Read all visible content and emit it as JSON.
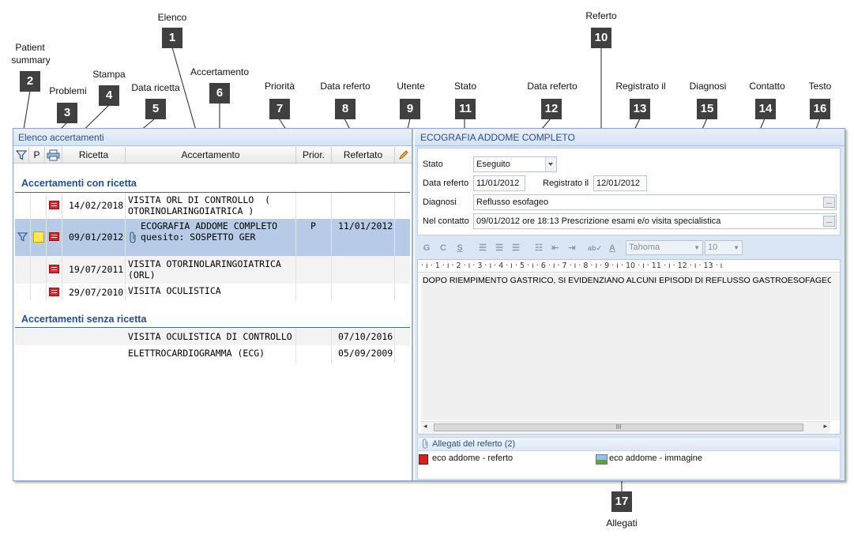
{
  "callouts": [
    {
      "num": "1",
      "label": "Elenco"
    },
    {
      "num": "2",
      "label_line1": "Patient",
      "label_line2": "summary"
    },
    {
      "num": "3",
      "label": "Problemi"
    },
    {
      "num": "4",
      "label": "Stampa"
    },
    {
      "num": "5",
      "label": "Data ricetta"
    },
    {
      "num": "6",
      "label": "Accertamento"
    },
    {
      "num": "7",
      "label": "Priorità"
    },
    {
      "num": "8",
      "label": "Data referto"
    },
    {
      "num": "9",
      "label": "Utente"
    },
    {
      "num": "10",
      "label": "Referto"
    },
    {
      "num": "11",
      "label": "Stato"
    },
    {
      "num": "12",
      "label": "Data referto"
    },
    {
      "num": "13",
      "label": "Registrato il"
    },
    {
      "num": "14",
      "label": "Contatto"
    },
    {
      "num": "15",
      "label": "Diagnosi"
    },
    {
      "num": "16",
      "label": "Testo"
    },
    {
      "num": "17",
      "label": "Allegati"
    }
  ],
  "left_panel": {
    "title": "Elenco accertamenti",
    "columns": {
      "p": "P",
      "ricetta": "Ricetta",
      "accertamento": "Accertamento",
      "prior": "Prior.",
      "refertato": "Refertato"
    },
    "group_with": "Accertamenti con ricetta",
    "group_without": "Accertamenti senza ricetta",
    "rows_with": [
      {
        "date": "14/02/2018",
        "exam_line1": "VISITA ORL DI CONTROLLO  (",
        "exam_line2": "OTORINOLARINGOIATRICA )",
        "prior": "",
        "reported": ""
      },
      {
        "date": "09/01/2012",
        "exam_line1": "ECOGRAFIA ADDOME COMPLETO",
        "exam_line2": "quesito: SOSPETTO GER",
        "prior": "P",
        "reported": "11/01/2012"
      },
      {
        "date": "19/07/2011",
        "exam_line1": "VISITA OTORINOLARINGOIATRICA",
        "exam_line2": "(ORL)",
        "prior": "",
        "reported": ""
      },
      {
        "date": "29/07/2010",
        "exam_line1": "VISITA OCULISTICA",
        "prior": "",
        "reported": ""
      }
    ],
    "rows_without": [
      {
        "exam": "VISITA OCULISTICA DI CONTROLLO",
        "reported": "07/10/2016"
      },
      {
        "exam": "ELETTROCARDIOGRAMMA (ECG)",
        "reported": "05/09/2009"
      }
    ]
  },
  "right_panel": {
    "title": "ECOGRAFIA ADDOME COMPLETO",
    "stato_label": "Stato",
    "stato_value": "Eseguito",
    "data_referto_label": "Data referto",
    "data_referto_value": "11/01/2012",
    "registrato_label": "Registrato il",
    "registrato_value": "12/01/2012",
    "diagnosi_label": "Diagnosi",
    "diagnosi_value": "Reflusso esofageo",
    "contatto_label": "Nel contatto",
    "contatto_value": "09/01/2012 ore 18:13 Prescrizione esami e/o visita specialistica",
    "toolbar": {
      "bold": "G",
      "italic": "C",
      "underline": "S",
      "font": "Tahoma",
      "size": "10"
    },
    "ruler": "· ı · 1 · ı · 2 · ı · 3 · ı · 4 · ı · 5 · ı · 6 · ı · 7 · ı · 8 · ı · 9 · ı · 10 · ı · 11 · ı · 12 · ı · 13 · ı",
    "text": "DOPO RIEMPIMENTO GASTRICO, SI EVIDENZIANO ALCUNI EPISODI DI REFLUSSO GASTROESOFAGEO",
    "attachments_title": "Allegati del referto (2)",
    "attachments": [
      "eco addome - referto",
      "eco addome - immagine"
    ]
  },
  "icons": {
    "filter": "filter-icon",
    "print": "printer-icon",
    "edit": "pencil-icon",
    "paperclip": "paperclip-icon",
    "rx": "prescription-icon",
    "pdf": "pdf-icon",
    "image": "image-icon"
  },
  "colors": {
    "accent": "#1e4f91",
    "selected_row": "#b7cbe6",
    "header_blue": "#d5e4f6",
    "badge": "#404040"
  }
}
